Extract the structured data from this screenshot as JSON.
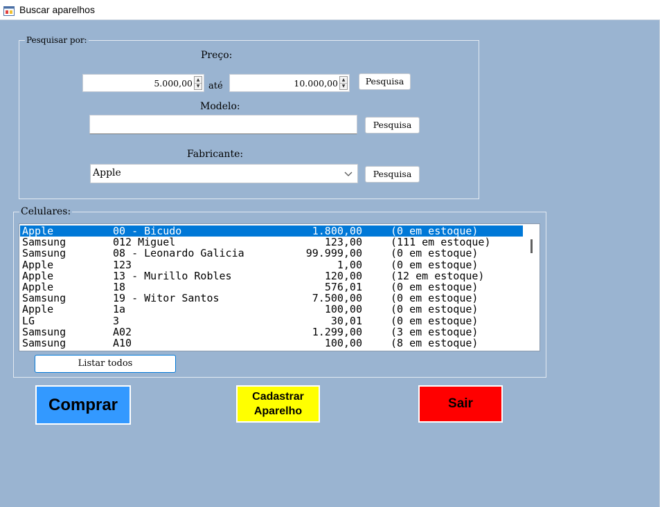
{
  "window": {
    "title": "Buscar aparelhos"
  },
  "search": {
    "legend": "Pesquisar por:",
    "price": {
      "label": "Preço:",
      "from_value": "5.000,00",
      "to_label": "até",
      "to_value": "10.000,00",
      "button": "Pesquisa"
    },
    "model": {
      "label": "Modelo:",
      "value": "",
      "button": "Pesquisa"
    },
    "maker": {
      "label": "Fabricante:",
      "selected": "Apple",
      "button": "Pesquisa"
    }
  },
  "phones": {
    "legend": "Celulares:",
    "rows": [
      {
        "maker": "Apple",
        "model": "00 - Bicudo",
        "price": "1.800,00",
        "stock": "(0 em estoque)",
        "selected": true
      },
      {
        "maker": "Samsung",
        "model": "012 Miguel",
        "price": "123,00",
        "stock": "(111 em estoque)"
      },
      {
        "maker": "Samsung",
        "model": "08 - Leonardo Galicia",
        "price": "99.999,00",
        "stock": "(0 em estoque)"
      },
      {
        "maker": "Apple",
        "model": "123",
        "price": "1,00",
        "stock": "(0 em estoque)"
      },
      {
        "maker": "Apple",
        "model": "13 - Murillo Robles",
        "price": "120,00",
        "stock": "(12 em estoque)"
      },
      {
        "maker": "Apple",
        "model": "18",
        "price": "576,01",
        "stock": "(0 em estoque)"
      },
      {
        "maker": "Samsung",
        "model": "19 - Witor Santos",
        "price": "7.500,00",
        "stock": "(0 em estoque)"
      },
      {
        "maker": "Apple",
        "model": "1a",
        "price": "100,00",
        "stock": "(0 em estoque)"
      },
      {
        "maker": "LG",
        "model": "3",
        "price": "30,01",
        "stock": "(0 em estoque)"
      },
      {
        "maker": "Samsung",
        "model": "A02",
        "price": "1.299,00",
        "stock": "(3 em estoque)"
      },
      {
        "maker": "Samsung",
        "model": "A10",
        "price": "100,00",
        "stock": "(8 em estoque)"
      }
    ],
    "list_all_button": "Listar todos"
  },
  "actions": {
    "buy": {
      "label": "Comprar",
      "color": "#3399ff"
    },
    "register": {
      "line1": "Cadastrar",
      "line2": "Aparelho",
      "color": "#ffff00"
    },
    "exit": {
      "label": "Sair",
      "color": "#ff0000"
    }
  }
}
